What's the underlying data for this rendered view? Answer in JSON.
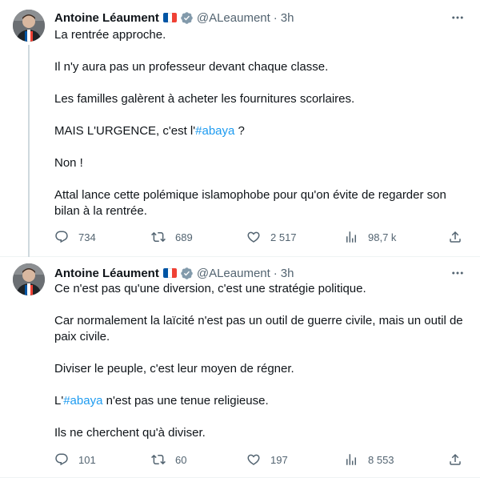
{
  "tweets": [
    {
      "author": {
        "name": "Antoine Léaument",
        "handle": "@ALeaument",
        "time": "3h",
        "flag_colors": [
          "#0055a4",
          "#ffffff",
          "#ef4135"
        ]
      },
      "body": {
        "p1": "La rentrée approche.",
        "p2": "Il n'y aura pas un professeur devant chaque classe.",
        "p3": "Les familles galèrent à acheter les fournitures scorlaires.",
        "p4_prefix": "MAIS L'URGENCE, c'est l'",
        "p4_hashtag": "#abaya",
        "p4_suffix": " ?",
        "p5": "Non !",
        "p6": "Attal lance cette polémique islamophobe pour qu'on évite de regarder son bilan à la rentrée."
      },
      "actions": {
        "replies": "734",
        "reposts": "689",
        "likes": "2 517",
        "views": "98,7 k"
      }
    },
    {
      "author": {
        "name": "Antoine Léaument",
        "handle": "@ALeaument",
        "time": "3h"
      },
      "body": {
        "p1": "Ce n'est pas qu'une diversion, c'est une stratégie politique.",
        "p2": "Car normalement la laïcité n'est pas un outil de guerre civile, mais un outil de paix civile.",
        "p3": "Diviser le peuple, c'est leur moyen de régner.",
        "p4_prefix": "L'",
        "p4_hashtag": "#abaya",
        "p4_suffix": " n'est pas une tenue religieuse.",
        "p5": "Ils ne cherchent qu'à diviser."
      },
      "actions": {
        "replies": "101",
        "reposts": "60",
        "likes": "197",
        "views": "8 553"
      }
    }
  ],
  "colors": {
    "text": "#0f1419",
    "secondary": "#536471",
    "link": "#1d9bf0",
    "divider": "#eff3f4"
  },
  "icons": [
    "more-icon",
    "verified-badge-icon",
    "reply-icon",
    "repost-icon",
    "like-icon",
    "views-icon",
    "share-icon"
  ]
}
